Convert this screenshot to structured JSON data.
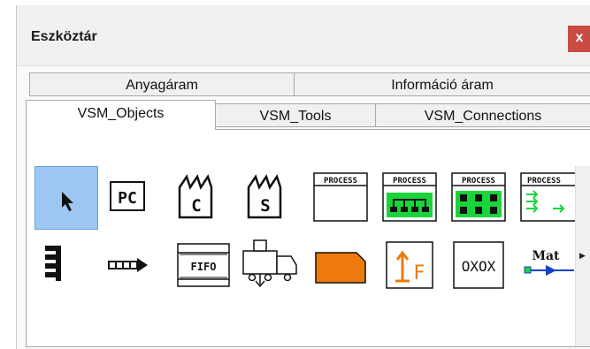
{
  "window": {
    "title": "Eszköztár",
    "close_label": "x",
    "accent": "#c94b43"
  },
  "tabs": {
    "row1": [
      {
        "label": "Anyagáram"
      },
      {
        "label": "Információ áram"
      }
    ],
    "row2": [
      {
        "label": "VSM_Objects",
        "active": true
      },
      {
        "label": "VSM_Tools",
        "active": false
      },
      {
        "label": "VSM_Connections",
        "active": false
      }
    ]
  },
  "tools": {
    "row1": [
      {
        "icon": "pointer-arrow-icon",
        "selected": true
      },
      {
        "icon": "production-control-icon",
        "text": "PC"
      },
      {
        "icon": "customer-factory-icon",
        "text": "C"
      },
      {
        "icon": "supplier-factory-icon",
        "text": "S"
      },
      {
        "icon": "process-box-icon",
        "text": "PROCESS"
      },
      {
        "icon": "process-shared-icon",
        "text": "PROCESS"
      },
      {
        "icon": "process-cell-icon",
        "text": "PROCESS"
      },
      {
        "icon": "process-flow-icon",
        "text": "PROCESS"
      }
    ],
    "row2": [
      {
        "icon": "inventory-buffer-icon"
      },
      {
        "icon": "push-arrow-icon"
      },
      {
        "icon": "fifo-lane-icon",
        "text": "FIFO"
      },
      {
        "icon": "truck-shipment-icon"
      },
      {
        "icon": "kanban-post-icon",
        "color": "#ee7a0e"
      },
      {
        "icon": "go-see-icon",
        "text": "F"
      },
      {
        "icon": "load-leveling-icon",
        "text": "OXOX"
      },
      {
        "icon": "material-flow-icon",
        "text": "Mat"
      }
    ]
  },
  "colors": {
    "selection": "#9bc7f2",
    "orange": "#ee7a0e",
    "green": "#19d43a",
    "blue": "#1240c8"
  }
}
